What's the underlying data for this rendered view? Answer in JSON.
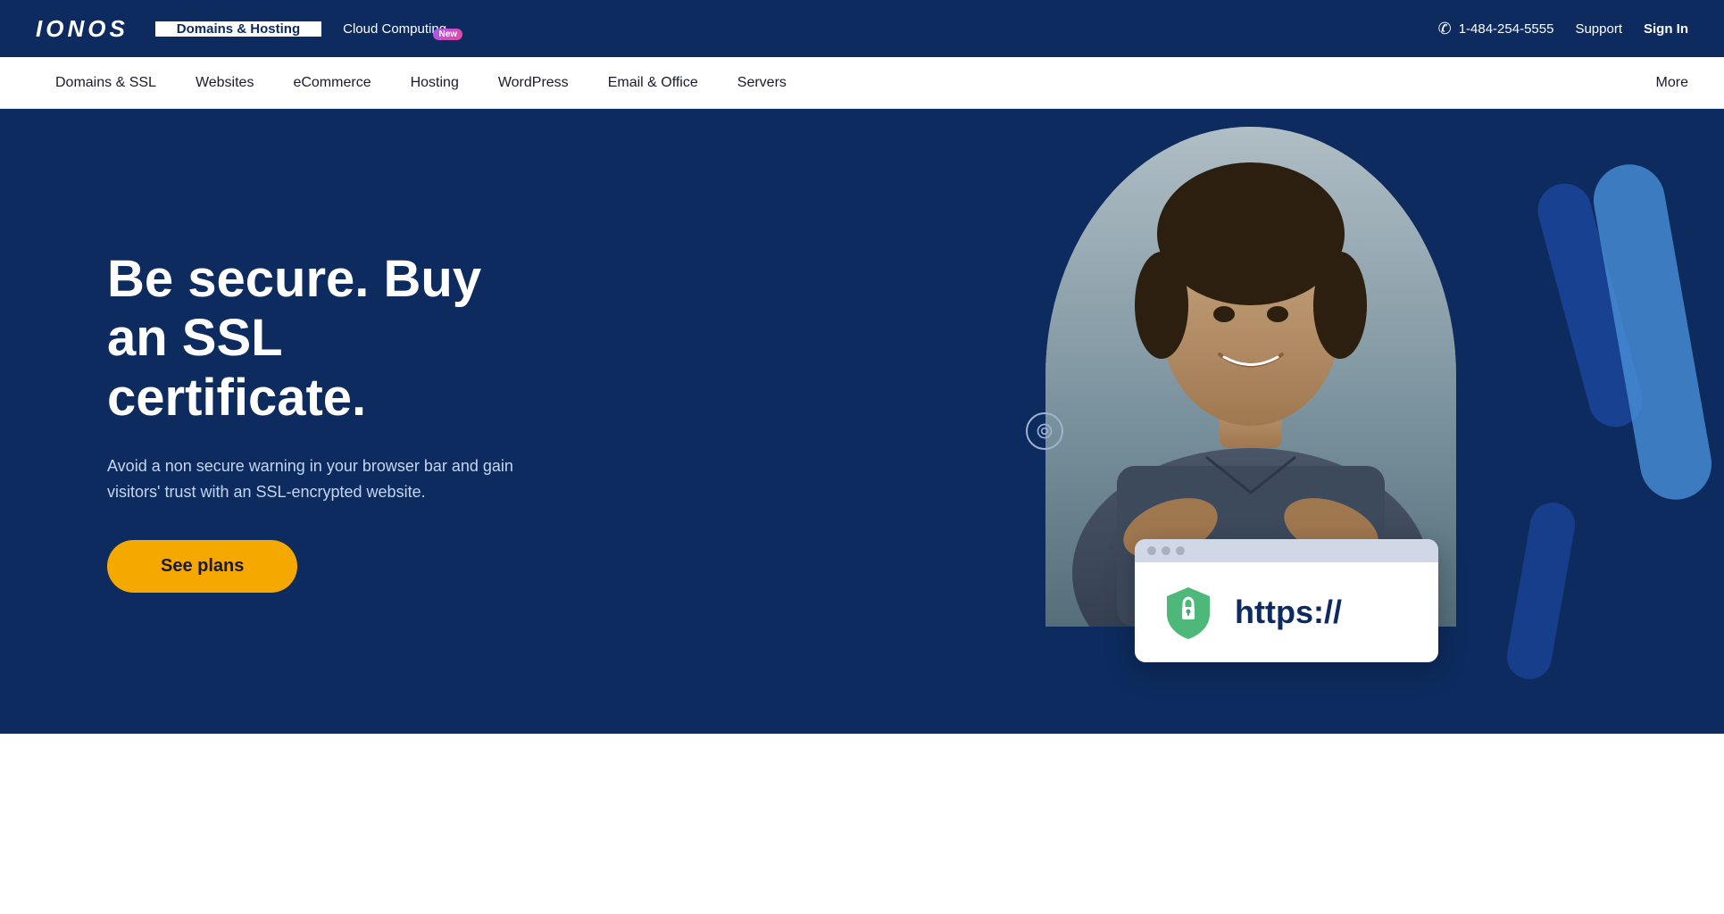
{
  "topbar": {
    "logo": "IONOS",
    "nav_tabs": [
      {
        "id": "domains-hosting",
        "label": "Domains & Hosting",
        "active": true,
        "badge": null
      },
      {
        "id": "cloud-computing",
        "label": "Cloud Computing",
        "active": false,
        "badge": "New"
      }
    ],
    "phone": "1-484-254-5555",
    "support_label": "Support",
    "signin_label": "Sign In"
  },
  "secondary_nav": {
    "items": [
      {
        "id": "domains-ssl",
        "label": "Domains & SSL"
      },
      {
        "id": "websites",
        "label": "Websites"
      },
      {
        "id": "ecommerce",
        "label": "eCommerce"
      },
      {
        "id": "hosting",
        "label": "Hosting"
      },
      {
        "id": "wordpress",
        "label": "WordPress"
      },
      {
        "id": "email-office",
        "label": "Email & Office"
      },
      {
        "id": "servers",
        "label": "Servers"
      }
    ],
    "more_label": "More"
  },
  "hero": {
    "title": "Be secure. Buy an SSL certificate.",
    "subtitle": "Avoid a non secure warning in your browser bar and gain visitors' trust with an SSL-encrypted website.",
    "cta_label": "See plans",
    "https_card": {
      "https_text": "https://"
    }
  },
  "colors": {
    "dark_navy": "#0d2b5e",
    "yellow": "#f5a800",
    "light_blue": "#4a90d9",
    "green_shield": "#3ab06a"
  }
}
